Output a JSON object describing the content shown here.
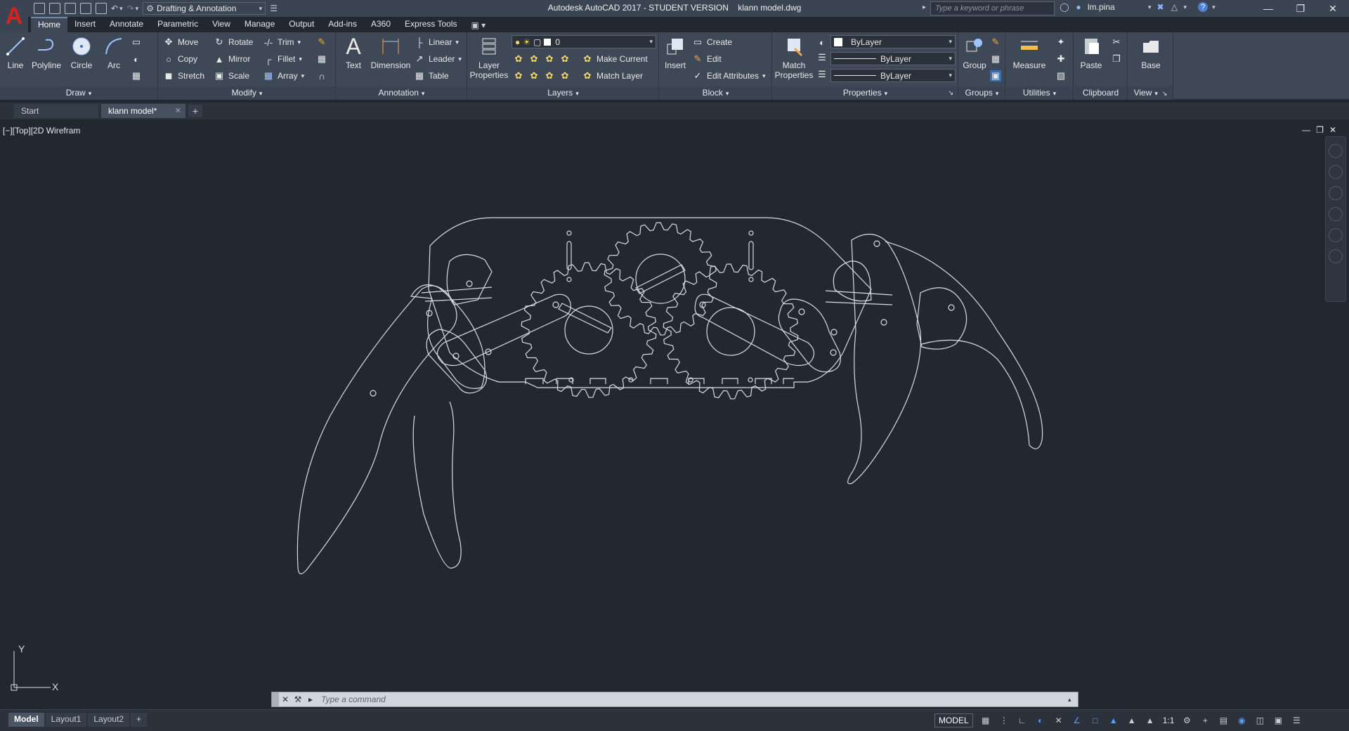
{
  "titlebar": {
    "workspace": "Drafting & Annotation",
    "title": "Autodesk AutoCAD 2017 - STUDENT VERSION    klann model.dwg",
    "search_placeholder": "Type a keyword or phrase",
    "user": "lm.pina"
  },
  "ribbon_tabs": [
    "Home",
    "Insert",
    "Annotate",
    "Parametric",
    "View",
    "Manage",
    "Output",
    "Add-ins",
    "A360",
    "Express Tools"
  ],
  "ribbon": {
    "draw": {
      "title": "Draw",
      "line": "Line",
      "polyline": "Polyline",
      "circle": "Circle",
      "arc": "Arc"
    },
    "modify": {
      "title": "Modify",
      "move": "Move",
      "rotate": "Rotate",
      "trim": "Trim",
      "copy": "Copy",
      "mirror": "Mirror",
      "fillet": "Fillet",
      "stretch": "Stretch",
      "scale": "Scale",
      "array": "Array"
    },
    "annotation": {
      "title": "Annotation",
      "text": "Text",
      "dimension": "Dimension",
      "linear": "Linear",
      "leader": "Leader",
      "table": "Table"
    },
    "layers": {
      "title": "Layers",
      "layer_properties_1": "Layer",
      "layer_properties_2": "Properties",
      "current_layer": "0",
      "make_current": "Make Current",
      "match_layer": "Match Layer"
    },
    "block": {
      "title": "Block",
      "insert": "Insert",
      "create": "Create",
      "edit": "Edit",
      "edit_attributes": "Edit Attributes"
    },
    "properties": {
      "title": "Properties",
      "match_1": "Match",
      "match_2": "Properties",
      "color": "ByLayer",
      "linetype": "ByLayer",
      "lineweight": "ByLayer"
    },
    "groups": {
      "title": "Groups",
      "group": "Group"
    },
    "utilities": {
      "title": "Utilities",
      "measure": "Measure"
    },
    "clipboard": {
      "title": "Clipboard",
      "paste": "Paste"
    },
    "view": {
      "title": "View",
      "base": "Base"
    }
  },
  "file_tabs": [
    "Start",
    "klann model*"
  ],
  "viewport": {
    "label": "[−][Top][2D Wirefram",
    "ucs_x": "X",
    "ucs_y": "Y"
  },
  "command": {
    "placeholder": "Type  a  command"
  },
  "status": {
    "layouts": [
      "Model",
      "Layout1",
      "Layout2"
    ],
    "model": "MODEL",
    "scale": "1:1"
  },
  "colors": {
    "background": "#212830",
    "ribbon": "#3f4857",
    "line": "#d8dde4",
    "logo": "#d6231e"
  }
}
